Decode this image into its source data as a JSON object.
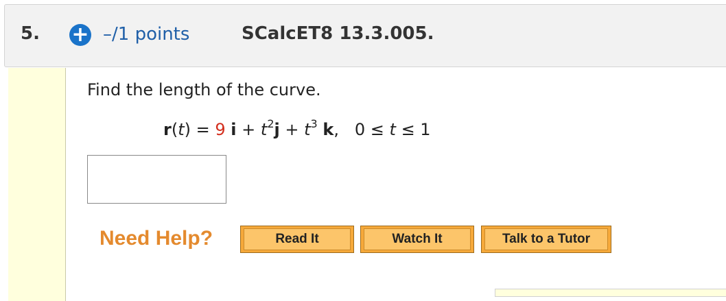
{
  "question": {
    "number": "5.",
    "points": "–/1 points",
    "reference": "SCalcET8 13.3.005.",
    "prompt": "Find the length of the curve.",
    "formula": {
      "lhs": "r",
      "open_paren": "(",
      "var_t": "t",
      "close_eq": ") = ",
      "coef": "9",
      "i": "i",
      "plus1": " + ",
      "t2_base": "t",
      "t2_exp": "2",
      "j": "j",
      "plus2": " + ",
      "t3_base": "t",
      "t3_exp": "3",
      "k": "k",
      "comma": ",",
      "range_prefix": "   0 ≤ ",
      "range_var": "t",
      "range_suffix": " ≤ 1"
    },
    "answer_value": ""
  },
  "help": {
    "label": "Need Help?",
    "buttons": {
      "read": "Read It",
      "watch": "Watch It",
      "tutor": "Talk to a Tutor"
    }
  },
  "colors": {
    "accent_blue": "#1a73c9",
    "points_blue": "#1f5fa8",
    "highlight_red": "#d32f1e",
    "help_orange": "#e48a2e",
    "button_fill": "#fcc56a",
    "margin_yellow": "#ffffdd"
  },
  "icons": {
    "expand": "plus-circle-icon"
  }
}
